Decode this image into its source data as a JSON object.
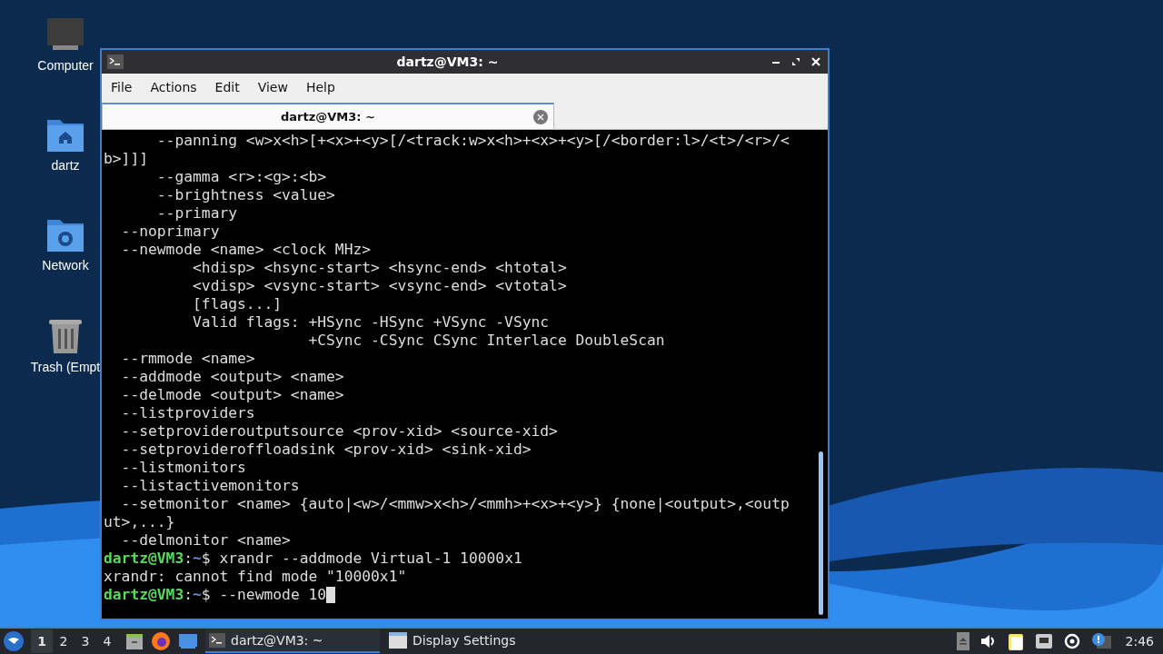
{
  "desktop_icons": [
    {
      "kind": "computer",
      "label": "Computer"
    },
    {
      "kind": "home",
      "label": "dartz"
    },
    {
      "kind": "network",
      "label": "Network"
    },
    {
      "kind": "trash",
      "label": "Trash (Empt"
    }
  ],
  "window": {
    "title": "dartz@VM3: ~",
    "menu": [
      "File",
      "Actions",
      "Edit",
      "View",
      "Help"
    ],
    "tabs": [
      {
        "label": "dartz@VM3: ~",
        "selected": true
      }
    ],
    "terminal": {
      "lines": [
        {
          "kind": "output",
          "text": "      --panning <w>x<h>[+<x>+<y>[/<track:w>x<h>+<x>+<y>[/<border:l>/<t>/<r>/<"
        },
        {
          "kind": "output",
          "text": "b>]]]"
        },
        {
          "kind": "output",
          "text": "      --gamma <r>:<g>:<b>"
        },
        {
          "kind": "output",
          "text": "      --brightness <value>"
        },
        {
          "kind": "output",
          "text": "      --primary"
        },
        {
          "kind": "output",
          "text": "  --noprimary"
        },
        {
          "kind": "output",
          "text": "  --newmode <name> <clock MHz>"
        },
        {
          "kind": "output",
          "text": "          <hdisp> <hsync-start> <hsync-end> <htotal>"
        },
        {
          "kind": "output",
          "text": "          <vdisp> <vsync-start> <vsync-end> <vtotal>"
        },
        {
          "kind": "output",
          "text": "          [flags...]"
        },
        {
          "kind": "output",
          "text": "          Valid flags: +HSync -HSync +VSync -VSync"
        },
        {
          "kind": "output",
          "text": "                       +CSync -CSync CSync Interlace DoubleScan"
        },
        {
          "kind": "output",
          "text": "  --rmmode <name>"
        },
        {
          "kind": "output",
          "text": "  --addmode <output> <name>"
        },
        {
          "kind": "output",
          "text": "  --delmode <output> <name>"
        },
        {
          "kind": "output",
          "text": "  --listproviders"
        },
        {
          "kind": "output",
          "text": "  --setprovideroutputsource <prov-xid> <source-xid>"
        },
        {
          "kind": "output",
          "text": "  --setprovideroffloadsink <prov-xid> <sink-xid>"
        },
        {
          "kind": "output",
          "text": "  --listmonitors"
        },
        {
          "kind": "output",
          "text": "  --listactivemonitors"
        },
        {
          "kind": "output",
          "text": "  --setmonitor <name> {auto|<w>/<mmw>x<h>/<mmh>+<x>+<y>} {none|<output>,<outp"
        },
        {
          "kind": "output",
          "text": "ut>,...}"
        },
        {
          "kind": "output",
          "text": "  --delmonitor <name>"
        },
        {
          "kind": "prompt",
          "user": "dartz@VM3",
          "sep": ":",
          "dir": "~",
          "text": "$ xrandr --addmode Virtual-1 10000x1"
        },
        {
          "kind": "output",
          "text": "xrandr: cannot find mode \"10000x1\""
        },
        {
          "kind": "prompt",
          "user": "dartz@VM3",
          "sep": ":",
          "dir": "~",
          "text": "$ --newmode 10",
          "cursor": true
        }
      ]
    }
  },
  "taskbar": {
    "workspaces": [
      {
        "label": "1",
        "selected": true
      },
      {
        "label": "2",
        "selected": false
      },
      {
        "label": "3",
        "selected": false
      },
      {
        "label": "4",
        "selected": false
      }
    ],
    "tasks": [
      {
        "kind": "terminal",
        "label": "dartz@VM3: ~",
        "selected": true
      },
      {
        "kind": "settings",
        "label": "Display Settings",
        "selected": false
      }
    ],
    "clock": "2:46"
  }
}
